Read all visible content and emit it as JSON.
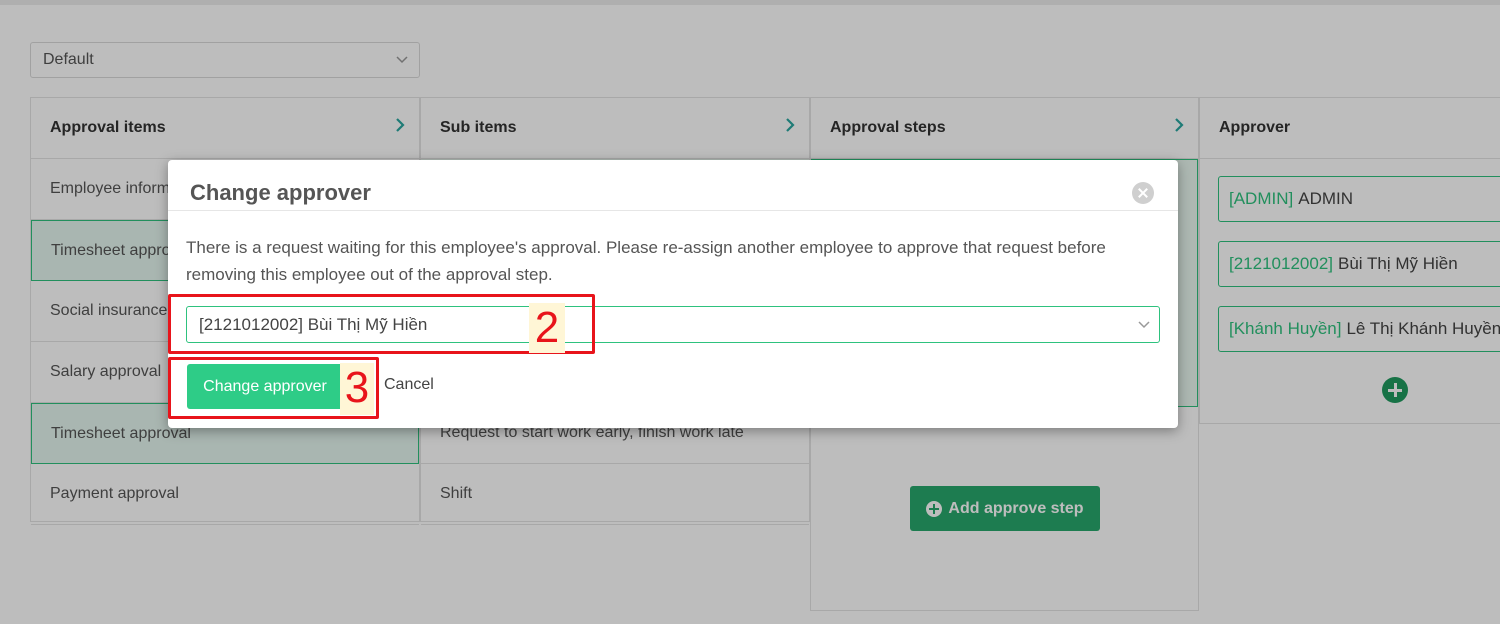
{
  "top_select": {
    "value": "Default"
  },
  "columns": {
    "approval_items": {
      "header": "Approval items",
      "items": [
        "Employee information",
        "Timesheet approval",
        "Social insurance",
        "Salary approval",
        "Timesheet approval",
        "Payment approval"
      ]
    },
    "sub_items": {
      "header": "Sub items",
      "items": [
        "",
        "",
        "",
        "",
        "Request to start work early, finish work late",
        "Shift"
      ]
    },
    "approval_steps": {
      "header": "Approval steps",
      "add_button": "Add approve step"
    },
    "approver": {
      "header": "Approver",
      "items": [
        {
          "code": "[ADMIN]",
          "name": "ADMIN"
        },
        {
          "code": "[2121012002]",
          "name": "Bùi Thị Mỹ Hiền"
        },
        {
          "code": "[Khánh Huyền]",
          "name": "Lê Thị Khánh Huyền"
        }
      ]
    }
  },
  "modal": {
    "title": "Change approver",
    "message": "There is a request waiting for this employee's approval. Please re-assign another employee to approve that request before removing this employee out of the approval step.",
    "select_value": "[2121012002] Bùi Thị Mỹ Hiền",
    "confirm_label": "Change approver",
    "cancel_label": "Cancel"
  },
  "annotations": {
    "step_2": "2",
    "step_3": "3"
  },
  "colors": {
    "accent": "#2ecc87",
    "annotation": "#e8141b"
  }
}
